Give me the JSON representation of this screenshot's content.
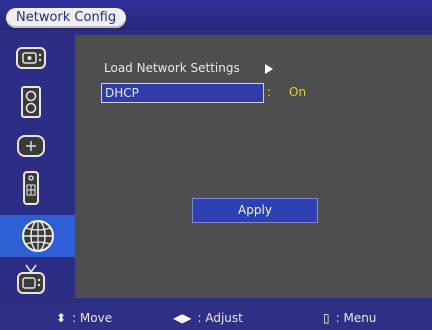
{
  "header": {
    "title": "Network Config"
  },
  "sidebar": {
    "items": [
      {
        "icon": "picture-icon"
      },
      {
        "icon": "speaker-icon"
      },
      {
        "icon": "setup-icon"
      },
      {
        "icon": "remote-icon"
      },
      {
        "icon": "network-icon",
        "active": true
      },
      {
        "icon": "tv-input-icon"
      }
    ]
  },
  "main": {
    "load_label": "Load Network Settings",
    "dhcp_label": "DHCP",
    "dhcp_colon": ":",
    "dhcp_value": "On",
    "apply_label": "Apply"
  },
  "footer": {
    "move_symbol": "⬍",
    "move_label": ": Move",
    "adjust_symbol": "◀▶",
    "adjust_label": ": Adjust",
    "menu_symbol": "▯",
    "menu_label": ": Menu"
  },
  "colors": {
    "accent": "#2f5fd6",
    "value_yellow": "#e6d020",
    "panel": "#4e4e4e",
    "bar": "#2f2f86"
  }
}
